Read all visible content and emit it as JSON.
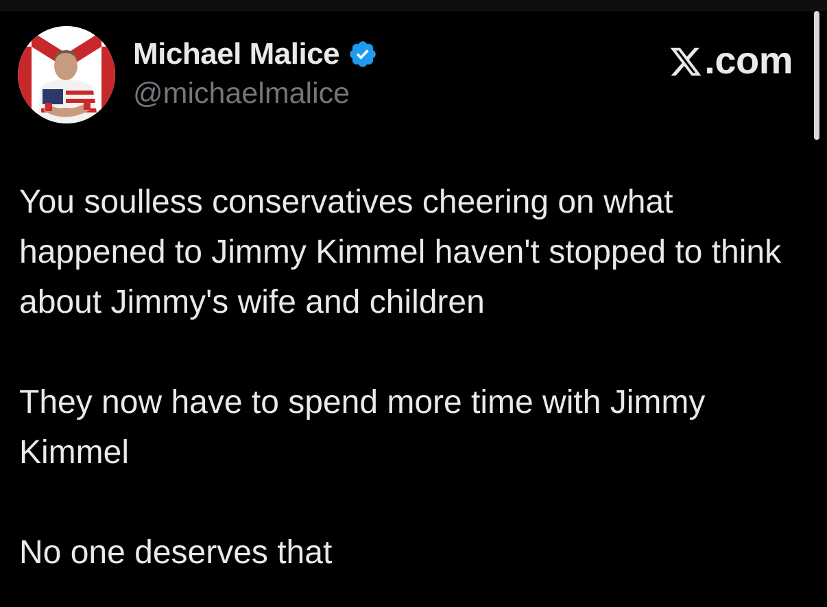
{
  "author": {
    "display_name": "Michael Malice",
    "handle": "@michaelmalice",
    "verified_icon": "verified-badge-icon",
    "avatar_icon": "profile-avatar"
  },
  "brand": {
    "label": ".com",
    "icon": "x-logo-icon"
  },
  "tweet": {
    "paragraphs": [
      "You soulless conservatives cheering on what happened to Jimmy Kimmel haven't stopped to think about Jimmy's wife and children",
      "They now have to spend more time with Jimmy Kimmel",
      "No one deserves that"
    ]
  },
  "colors": {
    "background": "#000000",
    "text": "#e7e9ea",
    "secondary_text": "#71767b",
    "verified_blue": "#1d9bf0"
  }
}
